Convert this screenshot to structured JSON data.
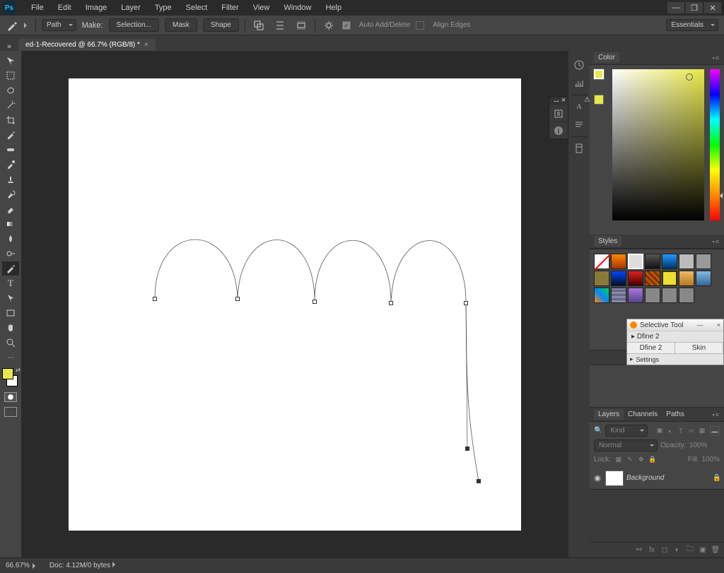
{
  "titlebar": {
    "logo": "Ps"
  },
  "menu": {
    "items": [
      "File",
      "Edit",
      "Image",
      "Layer",
      "Type",
      "Select",
      "Filter",
      "View",
      "Window",
      "Help"
    ]
  },
  "options": {
    "mode": "Path",
    "make_label": "Make:",
    "selection": "Selection...",
    "mask": "Mask",
    "shape": "Shape",
    "auto": "Auto Add/Delete",
    "align": "Align Edges",
    "workspace": "Essentials"
  },
  "tab": {
    "title": "ed-1-Recovered @ 66.7% (RGB/8) *"
  },
  "color": {
    "title": "Color"
  },
  "styles": {
    "title": "Styles"
  },
  "seltool": {
    "title": "Selective Tool",
    "sub": "Dfine 2",
    "t1": "Dfine 2",
    "t2": "Skin",
    "settings": "Settings"
  },
  "layers": {
    "tabs": [
      "Layers",
      "Channels",
      "Paths"
    ],
    "kind": "Kind",
    "blend": "Normal",
    "opacity_label": "Opacity:",
    "opacity_val": "100%",
    "lock_label": "Lock:",
    "fill_label": "Fill:",
    "fill_val": "100%",
    "bg_layer": "Background"
  },
  "status": {
    "zoom": "66.67%",
    "doc": "Doc: 4.12M/0 bytes"
  }
}
